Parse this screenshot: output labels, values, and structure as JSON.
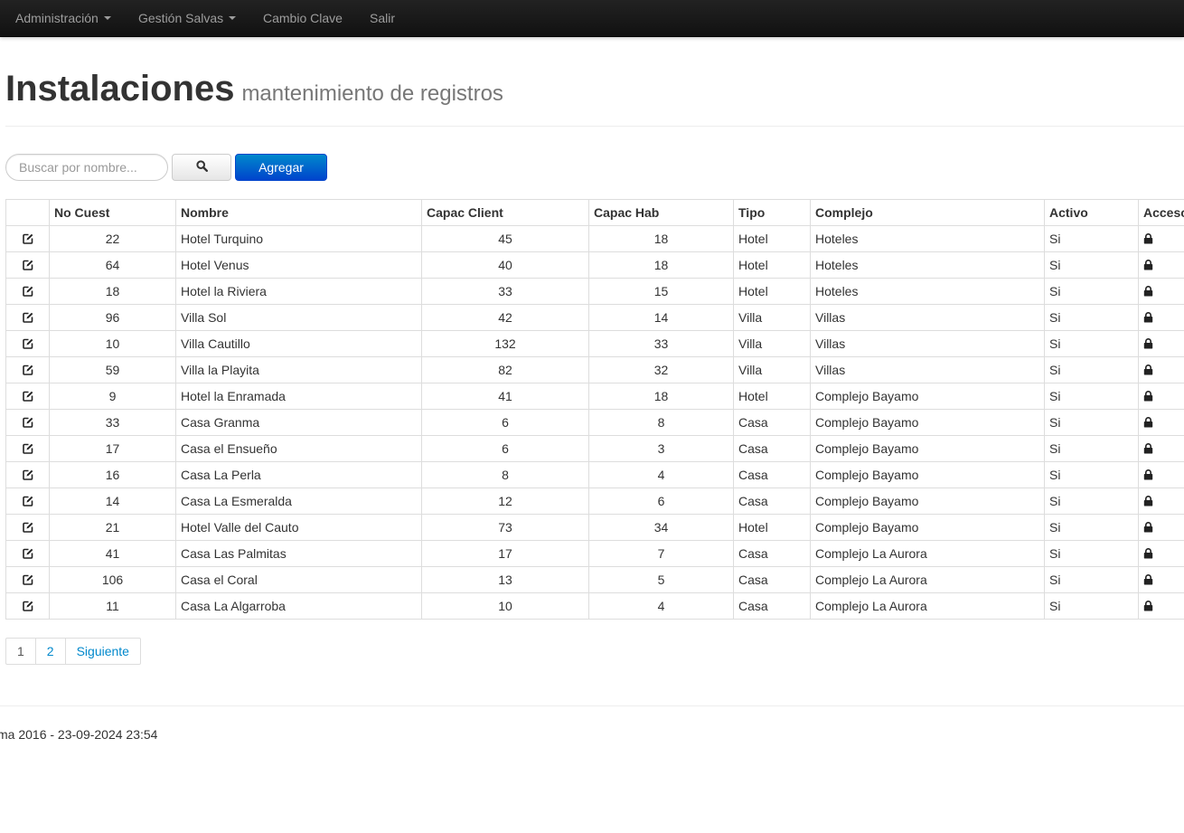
{
  "navbar": {
    "items": [
      {
        "label": "Administración",
        "dropdown": true
      },
      {
        "label": "Gestión Salvas",
        "dropdown": true
      },
      {
        "label": "Cambio Clave",
        "dropdown": false
      },
      {
        "label": "Salir",
        "dropdown": false
      }
    ]
  },
  "header": {
    "title": "Instalaciones",
    "subtitle": "mantenimiento de registros"
  },
  "toolbar": {
    "search_placeholder": "Buscar por nombre...",
    "search_value": "",
    "search_icon": "search-icon",
    "add_label": "Agregar"
  },
  "table": {
    "columns": [
      "",
      "No Cuest",
      "Nombre",
      "Capac Client",
      "Capac Hab",
      "Tipo",
      "Complejo",
      "Activo",
      "Acceso"
    ],
    "row_icons": {
      "edit": "edit-icon",
      "access": "lock-icon"
    },
    "rows": [
      {
        "no_cuest": "22",
        "nombre": "Hotel Turquino",
        "capac_client": "45",
        "capac_hab": "18",
        "tipo": "Hotel",
        "complejo": "Hoteles",
        "activo": "Si"
      },
      {
        "no_cuest": "64",
        "nombre": "Hotel Venus",
        "capac_client": "40",
        "capac_hab": "18",
        "tipo": "Hotel",
        "complejo": "Hoteles",
        "activo": "Si"
      },
      {
        "no_cuest": "18",
        "nombre": "Hotel la Riviera",
        "capac_client": "33",
        "capac_hab": "15",
        "tipo": "Hotel",
        "complejo": "Hoteles",
        "activo": "Si"
      },
      {
        "no_cuest": "96",
        "nombre": "Villa Sol",
        "capac_client": "42",
        "capac_hab": "14",
        "tipo": "Villa",
        "complejo": "Villas",
        "activo": "Si"
      },
      {
        "no_cuest": "10",
        "nombre": "Villa Cautillo",
        "capac_client": "132",
        "capac_hab": "33",
        "tipo": "Villa",
        "complejo": "Villas",
        "activo": "Si"
      },
      {
        "no_cuest": "59",
        "nombre": "Villa la Playita",
        "capac_client": "82",
        "capac_hab": "32",
        "tipo": "Villa",
        "complejo": "Villas",
        "activo": "Si"
      },
      {
        "no_cuest": "9",
        "nombre": "Hotel la Enramada",
        "capac_client": "41",
        "capac_hab": "18",
        "tipo": "Hotel",
        "complejo": "Complejo Bayamo",
        "activo": "Si"
      },
      {
        "no_cuest": "33",
        "nombre": "Casa Granma",
        "capac_client": "6",
        "capac_hab": "8",
        "tipo": "Casa",
        "complejo": "Complejo Bayamo",
        "activo": "Si"
      },
      {
        "no_cuest": "17",
        "nombre": "Casa el Ensueño",
        "capac_client": "6",
        "capac_hab": "3",
        "tipo": "Casa",
        "complejo": "Complejo Bayamo",
        "activo": "Si"
      },
      {
        "no_cuest": "16",
        "nombre": "Casa La Perla",
        "capac_client": "8",
        "capac_hab": "4",
        "tipo": "Casa",
        "complejo": "Complejo Bayamo",
        "activo": "Si"
      },
      {
        "no_cuest": "14",
        "nombre": "Casa La Esmeralda",
        "capac_client": "12",
        "capac_hab": "6",
        "tipo": "Casa",
        "complejo": "Complejo Bayamo",
        "activo": "Si"
      },
      {
        "no_cuest": "21",
        "nombre": "Hotel Valle del Cauto",
        "capac_client": "73",
        "capac_hab": "34",
        "tipo": "Hotel",
        "complejo": "Complejo Bayamo",
        "activo": "Si"
      },
      {
        "no_cuest": "41",
        "nombre": "Casa Las Palmitas",
        "capac_client": "17",
        "capac_hab": "7",
        "tipo": "Casa",
        "complejo": "Complejo La Aurora",
        "activo": "Si"
      },
      {
        "no_cuest": "106",
        "nombre": "Casa el Coral",
        "capac_client": "13",
        "capac_hab": "5",
        "tipo": "Casa",
        "complejo": "Complejo La Aurora",
        "activo": "Si"
      },
      {
        "no_cuest": "11",
        "nombre": "Casa La Algarroba",
        "capac_client": "10",
        "capac_hab": "4",
        "tipo": "Casa",
        "complejo": "Complejo La Aurora",
        "activo": "Si"
      }
    ]
  },
  "pagination": {
    "pages": [
      "1",
      "2"
    ],
    "current": "1",
    "next_label": "Siguiente"
  },
  "footer": {
    "text": "ma 2016 - 23-09-2024 23:54"
  }
}
